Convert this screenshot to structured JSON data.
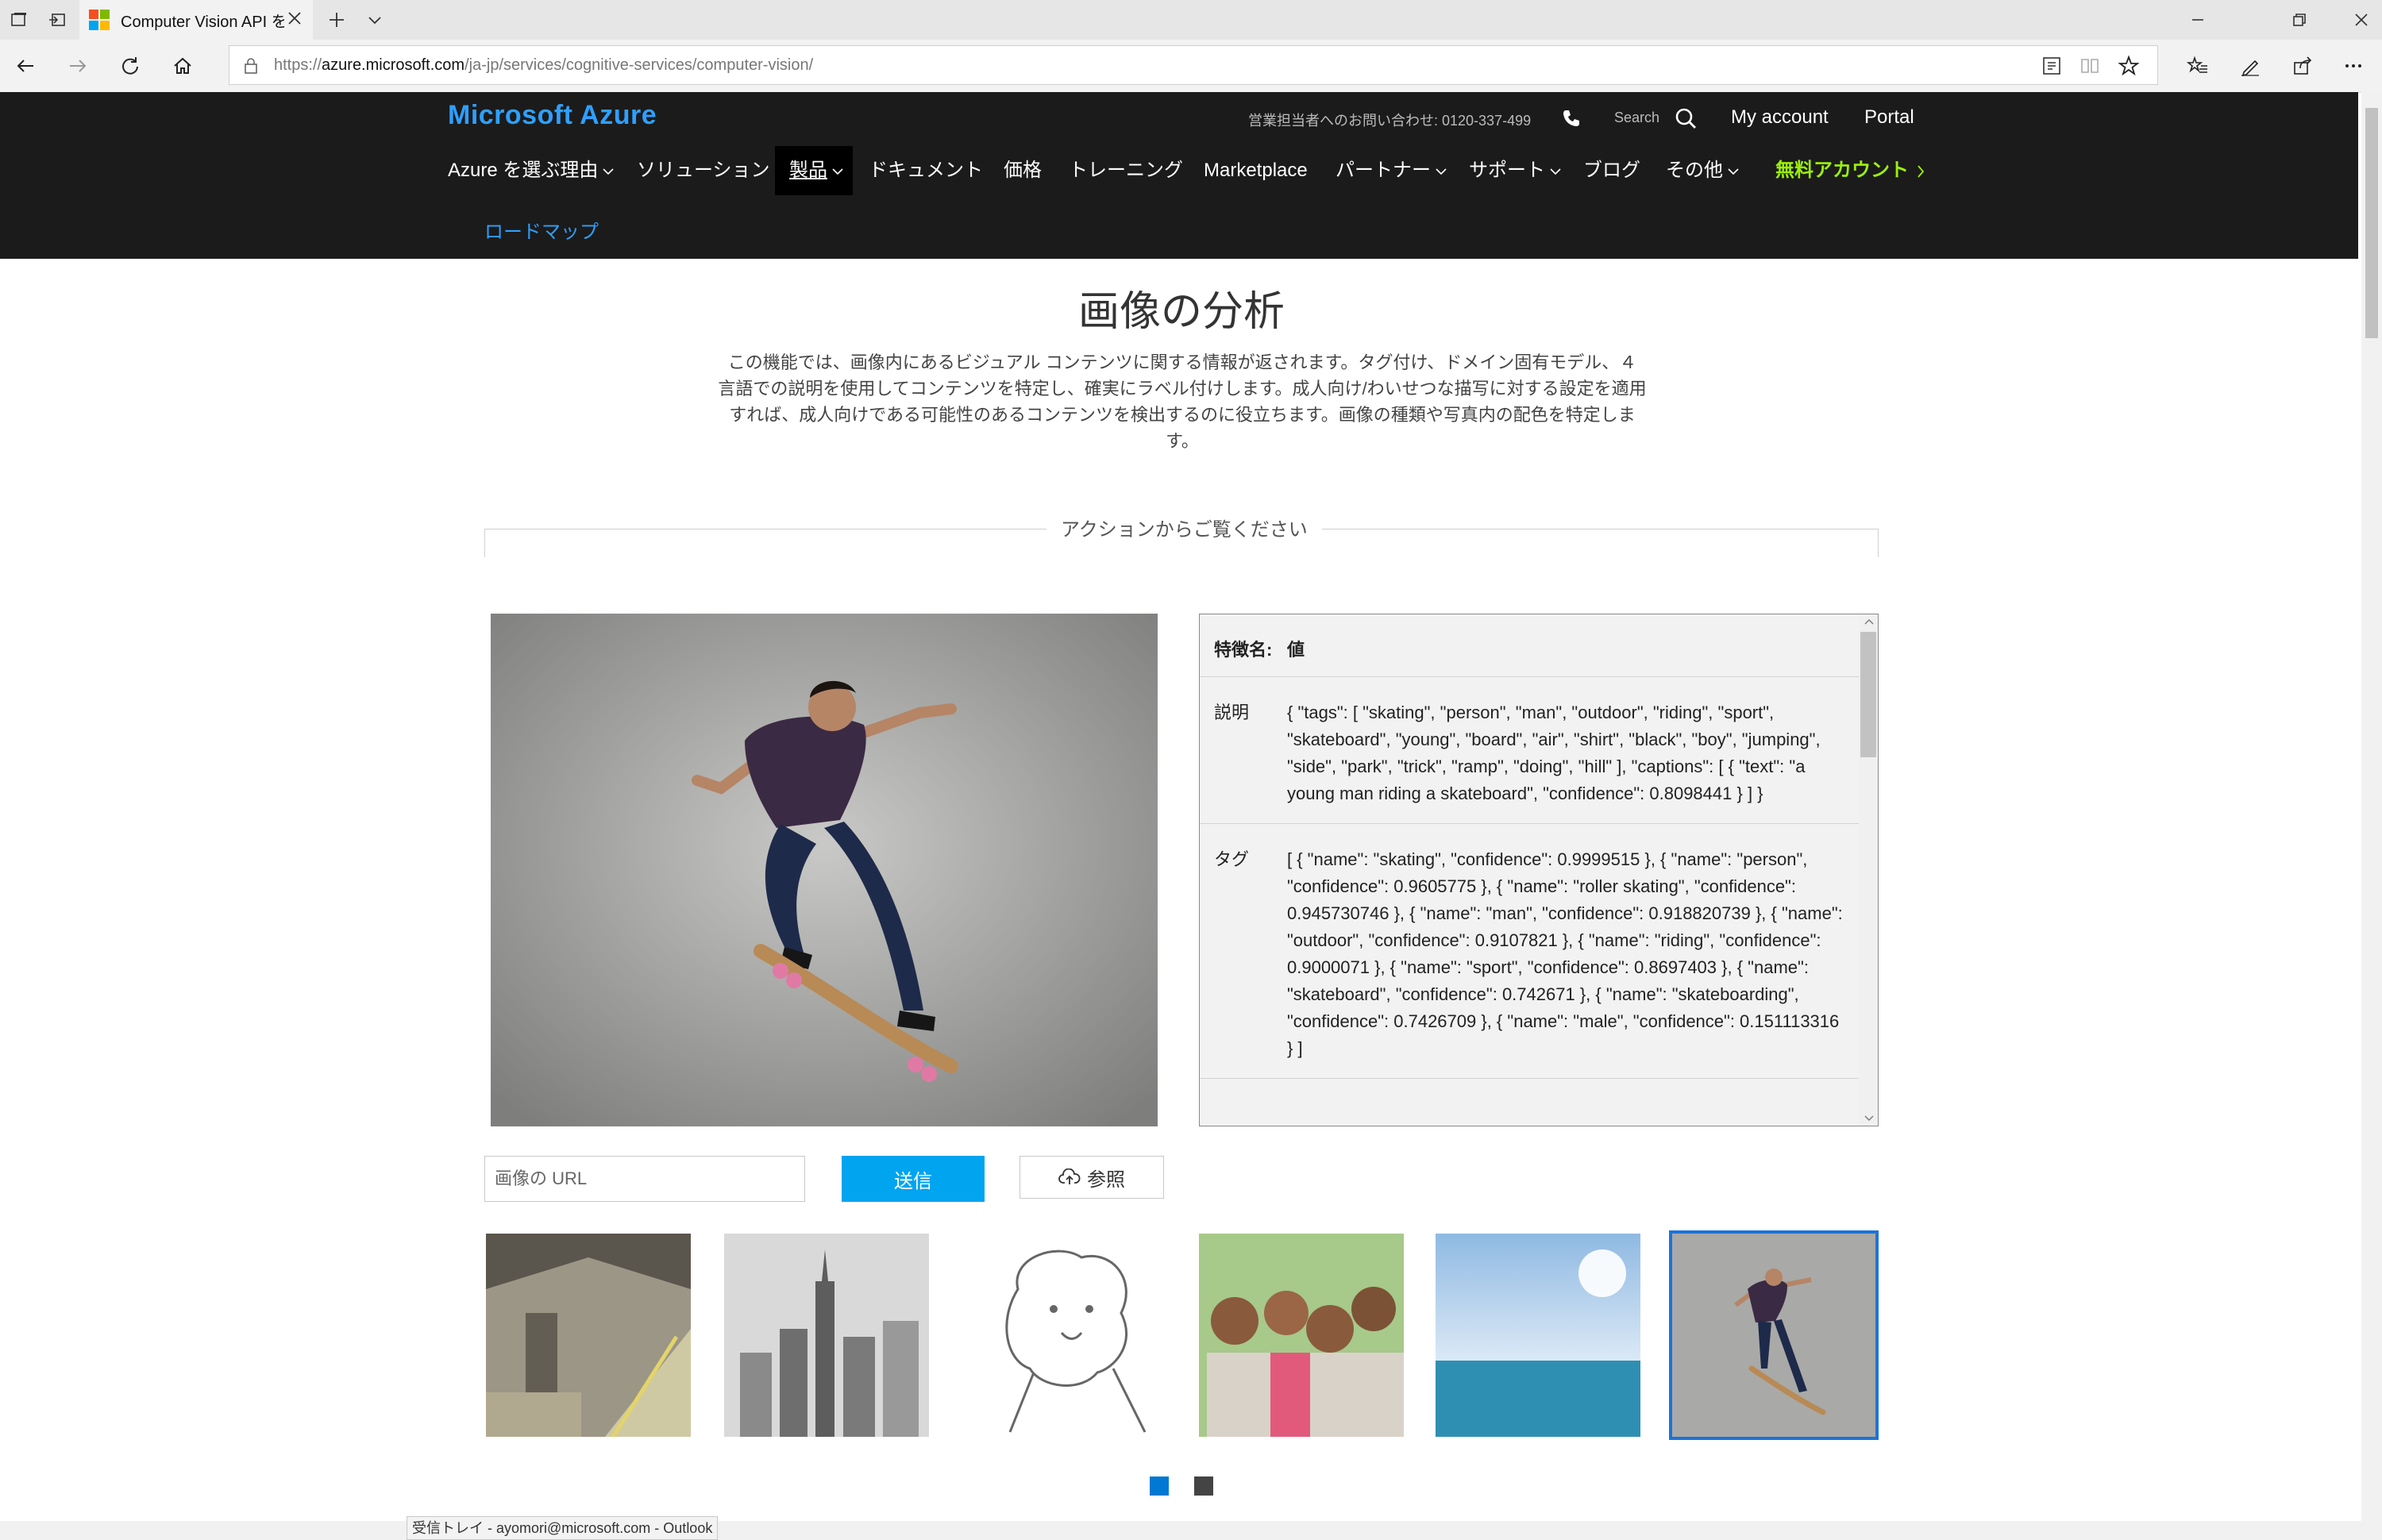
{
  "browser": {
    "tab_title": "Computer Vision API を",
    "url_prefix": "https://",
    "url_host": "azure.microsoft.com",
    "url_path": "/ja-jp/services/cognitive-services/computer-vision/"
  },
  "header": {
    "logo": "Microsoft Azure",
    "contact": "営業担当者へのお問い合わせ: 0120-337-499",
    "search_label": "Search",
    "my_account": "My account",
    "portal": "Portal",
    "nav": [
      "Azure を選ぶ理由",
      "ソリューション",
      "製品",
      "ドキュメント",
      "価格",
      "トレーニング",
      "Marketplace",
      "パートナー",
      "サポート",
      "ブログ",
      "その他",
      "無料アカウント"
    ],
    "roadmap": "ロードマップ"
  },
  "main": {
    "title": "画像の分析",
    "description": "この機能では、画像内にあるビジュアル コンテンツに関する情報が返されます。タグ付け、ドメイン固有モデル、４ 言語での説明を使用してコンテンツを特定し、確実にラベル付けします。成人向け/わいせつな描写に対する設定を適用すれば、成人向けである可能性のあるコンテンツを検出するのに役立ちます。画像の種類や写真内の配色を特定します。",
    "action_label": "アクションからご覧ください"
  },
  "results": {
    "header_key": "特徴名:",
    "header_value": "値",
    "rows": [
      {
        "key": "説明",
        "value": "{ \"tags\": [ \"skating\", \"person\", \"man\", \"outdoor\", \"riding\", \"sport\", \"skateboard\", \"young\", \"board\", \"air\", \"shirt\", \"black\", \"boy\", \"jumping\", \"side\", \"park\", \"trick\", \"ramp\", \"doing\", \"hill\" ], \"captions\": [ { \"text\": \"a young man riding a skateboard\", \"confidence\": 0.8098441 } ] }"
      },
      {
        "key": "タグ",
        "value": "[ { \"name\": \"skating\", \"confidence\": 0.9999515 }, { \"name\": \"person\", \"confidence\": 0.9605775 }, { \"name\": \"roller skating\", \"confidence\": 0.945730746 }, { \"name\": \"man\", \"confidence\": 0.918820739 }, { \"name\": \"outdoor\", \"confidence\": 0.9107821 }, { \"name\": \"riding\", \"confidence\": 0.9000071 }, { \"name\": \"sport\", \"confidence\": 0.8697403 }, { \"name\": \"skateboard\", \"confidence\": 0.742671 }, { \"name\": \"skateboarding\", \"confidence\": 0.7426709 }, { \"name\": \"male\", \"confidence\": 0.151113316 } ]"
      }
    ]
  },
  "controls": {
    "url_placeholder": "画像の URL",
    "send_label": "送信",
    "browse_label": "参照"
  },
  "status_tooltip": "受信トレイ - ayomori@microsoft.com - Outlook",
  "colors": {
    "azure_blue": "#2f9fff",
    "accent": "#00a4ef",
    "free_account_green": "#9bf00b",
    "header_bg": "#1b1b1b"
  }
}
